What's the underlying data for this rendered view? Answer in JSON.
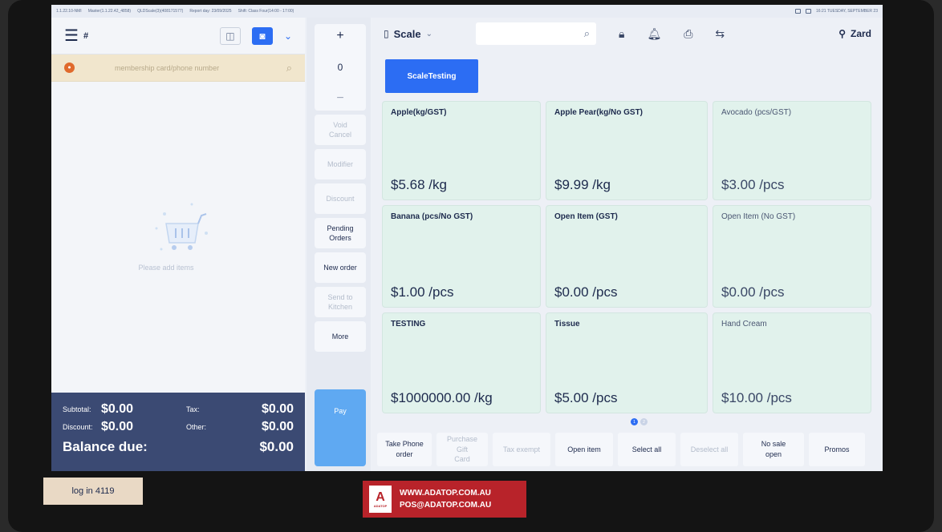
{
  "statusbar": {
    "version": "1.1.22.10-NMI",
    "master": "Master(1.1.22.42_4858)",
    "terminal": "QLDScale(3)(408171577)",
    "report_day": "Report day: 23/09/2025",
    "shift": "Shift: Class Four(14:00 - 17:00)",
    "datetime": "16:21 TUESDAY, SEPTEMBER 23"
  },
  "left": {
    "hash_label": "#",
    "member_placeholder": "membership card/phone number",
    "empty_text": "Please add items",
    "totals": {
      "subtotal_label": "Subtotal:",
      "subtotal": "$0.00",
      "tax_label": "Tax:",
      "tax": "$0.00",
      "discount_label": "Discount:",
      "discount": "$0.00",
      "other_label": "Other:",
      "other": "$0.00",
      "balance_label": "Balance due:",
      "balance": "$0.00"
    }
  },
  "middle": {
    "qty_plus": "+",
    "qty_value": "0",
    "qty_minus": "−",
    "buttons": [
      {
        "label": "Void\nCancel",
        "disabled": true
      },
      {
        "label": "Modifier",
        "disabled": true
      },
      {
        "label": "Discount",
        "disabled": true
      },
      {
        "label": "Pending\nOrders",
        "disabled": false
      },
      {
        "label": "New order",
        "disabled": false
      },
      {
        "label": "Send to\nKitchen",
        "disabled": true
      },
      {
        "label": "More",
        "disabled": false
      }
    ],
    "pay_label": "Pay"
  },
  "right": {
    "category_select": "Scale",
    "user": "Zard",
    "active_tab": "ScaleTesting",
    "products": [
      {
        "name": "Apple(kg/GST)",
        "price": "$5.68 /kg"
      },
      {
        "name": "Apple Pear(kg/No GST)",
        "price": "$9.99 /kg"
      },
      {
        "name": "Avocado (pcs/GST)",
        "price": "$3.00 /pcs"
      },
      {
        "name": "Banana (pcs/No GST)",
        "price": "$1.00 /pcs"
      },
      {
        "name": "Open Item (GST)",
        "price": "$0.00 /pcs"
      },
      {
        "name": "Open Item (No GST)",
        "price": "$0.00 /pcs"
      },
      {
        "name": "TESTING",
        "price": "$1000000.00 /kg"
      },
      {
        "name": "Tissue",
        "price": "$5.00 /pcs"
      },
      {
        "name": "Hand Cream",
        "price": "$10.00 /pcs"
      }
    ],
    "pages": [
      "1",
      "2"
    ],
    "bottom_buttons": [
      {
        "label": "Take Phone\norder",
        "disabled": false
      },
      {
        "label": "Purchase\nGift\nCard",
        "disabled": true
      },
      {
        "label": "Tax exempt",
        "disabled": true
      },
      {
        "label": "Open item",
        "disabled": false
      },
      {
        "label": "Select all",
        "disabled": false
      },
      {
        "label": "Deselect all",
        "disabled": true
      },
      {
        "label": "No sale\nopen",
        "disabled": false
      },
      {
        "label": "Promos",
        "disabled": false
      }
    ]
  },
  "hardware": {
    "login_label": "log in 4119",
    "sticker_brand": "ADATOP",
    "sticker_line1": "WWW.ADATOP.COM.AU",
    "sticker_line2": "POS@ADATOP.COM.AU"
  },
  "colors": {
    "accent": "#2c6df3",
    "totals_bg": "#3b4a73",
    "pay_bg": "#5fa9f2",
    "tile_bg": "#e1f2ec",
    "member_bg": "#f1e6cd"
  }
}
